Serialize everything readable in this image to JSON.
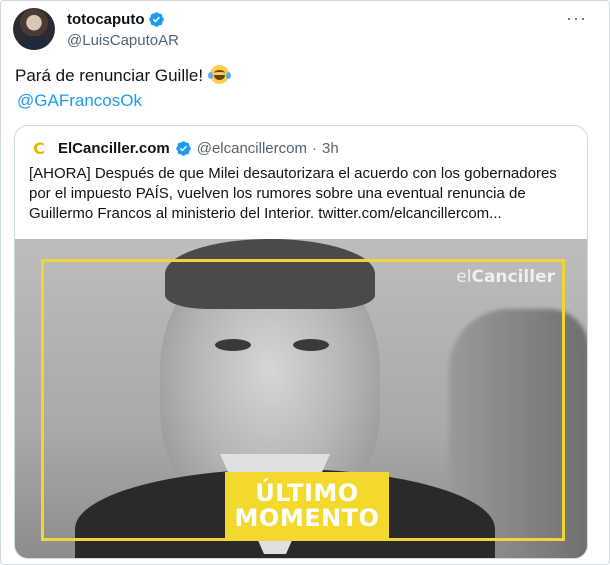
{
  "tweet": {
    "display_name": "totocaputo",
    "handle": "@LuisCaputoAR",
    "text": "Pará de renunciar Guille!",
    "mention": "@GAFrancosOk",
    "more_label": "···"
  },
  "quote": {
    "logo": "C",
    "name": "ElCanciller.com",
    "handle": "@elcancillercom",
    "dot": "·",
    "time": "3h",
    "text": "[AHORA] Después de que Milei desautorizara el acuerdo con los gobernadores por el impuesto PAÍS, vuelven los rumores sobre una eventual renuncia de Guillermo Francos al ministerio del Interior.  twitter.com/elcancillercom...",
    "image": {
      "brand_prefix": "el",
      "brand_name": "Canciller",
      "banner_line1": "ÚLTIMO",
      "banner_line2": "MOMENTO"
    }
  },
  "colors": {
    "accent": "#1d9bf0",
    "banner": "#f3d92b",
    "text": "#0f1419",
    "muted": "#536471"
  }
}
